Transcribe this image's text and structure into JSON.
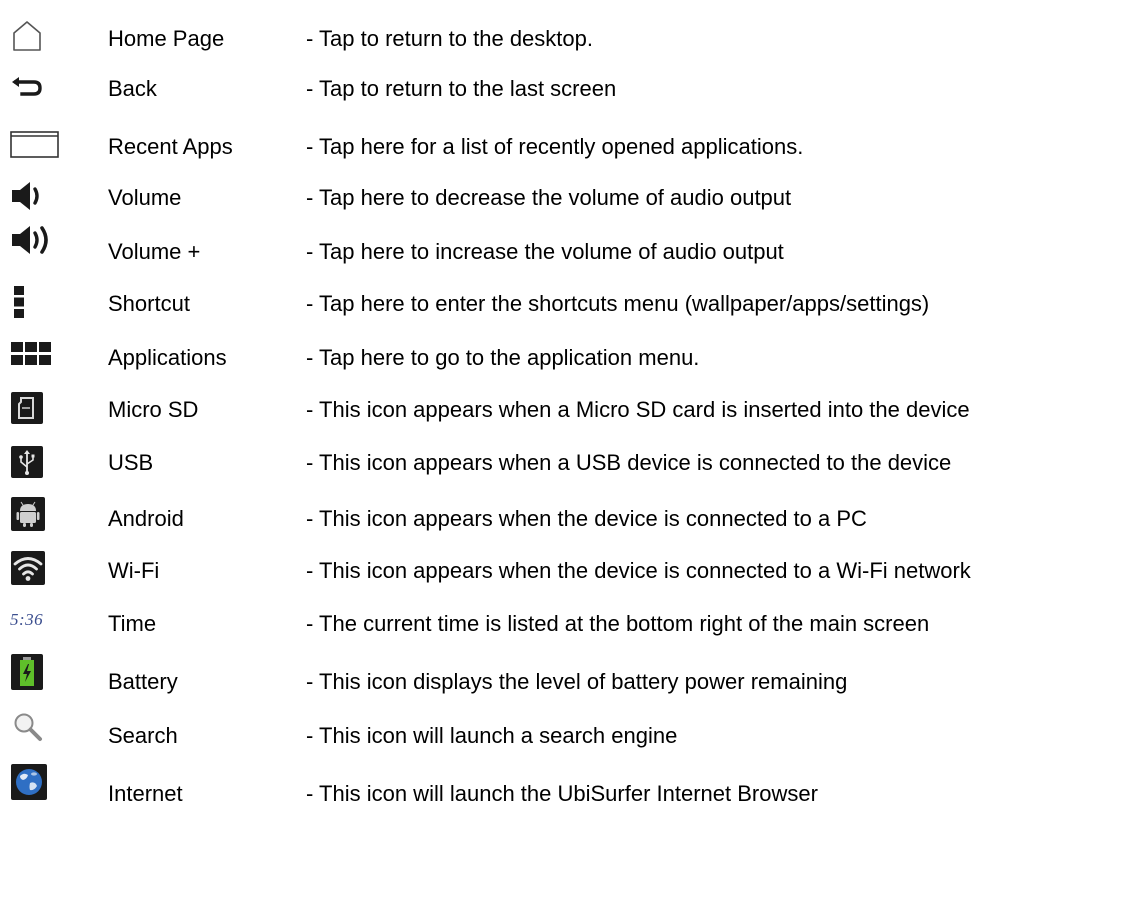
{
  "legend": {
    "items": [
      {
        "icon": "home-outline-icon",
        "name": "Home Page",
        "description": "- Tap to return to the desktop."
      },
      {
        "icon": "back-arrow-icon",
        "name": "Back",
        "description": "- Tap to return to the last screen"
      },
      {
        "icon": "recent-apps-icon",
        "name": "Recent Apps",
        "description": "- Tap here for a list of recently opened applications."
      },
      {
        "icon": "volume-down-icon",
        "name": "Volume",
        "description": "- Tap here to decrease the volume of audio output"
      },
      {
        "icon": "volume-up-icon",
        "name": "Volume +",
        "description": "- Tap here to increase the volume of audio output"
      },
      {
        "icon": "menu-dots-icon",
        "name": "Shortcut",
        "description": "- Tap here to enter the shortcuts menu (wallpaper/apps/settings)"
      },
      {
        "icon": "apps-grid-icon",
        "name": "Applications",
        "description": "- Tap here to go to the application menu."
      },
      {
        "icon": "micro-sd-icon",
        "name": "Micro SD",
        "description": "- This icon appears when a Micro SD card is inserted into the device"
      },
      {
        "icon": "usb-icon",
        "name": "USB",
        "description": "- This icon appears when a USB device is connected to the device"
      },
      {
        "icon": "android-icon",
        "name": "Android",
        "description": "- This icon appears when the device is connected to a PC"
      },
      {
        "icon": "wifi-icon",
        "name": "Wi-Fi",
        "description": "- This icon appears when the device is connected to a Wi-Fi network"
      },
      {
        "icon": "time-icon",
        "icon_text": "5:36",
        "name": "Time",
        "description": "- The current time is listed at the bottom right of the main screen"
      },
      {
        "icon": "battery-icon",
        "name": "Battery",
        "description": "- This icon displays the level of battery power remaining"
      },
      {
        "icon": "search-icon",
        "name": "Search",
        "description": "- This icon will launch a search engine"
      },
      {
        "icon": "globe-icon",
        "name": "Internet",
        "description": "- This icon will launch the UbiSurfer Internet Browser"
      }
    ]
  },
  "colors": {
    "text": "#000000",
    "icon_dark": "#1a1a1a",
    "time_text": "#3c4f8f",
    "battery_green": "#5fbf2a",
    "globe_blue": "#2f6fc4"
  }
}
